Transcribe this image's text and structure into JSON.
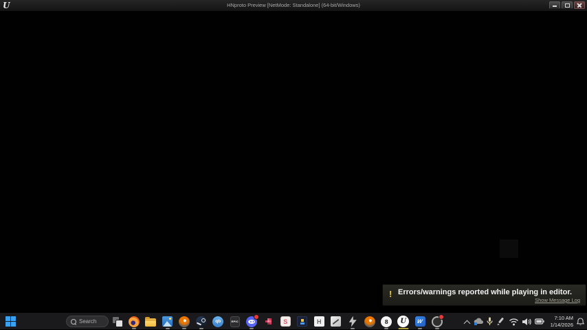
{
  "window": {
    "title": "HNproto Preview [NetMode: Standalone]  (64-bit/Windows)",
    "app_icon_glyph": "U",
    "controls": [
      "minimize",
      "maximize",
      "close"
    ]
  },
  "viewport": {
    "background": "#000000"
  },
  "toast": {
    "warning_glyph": "!",
    "message": "Errors/warnings reported while playing in editor.",
    "link_label": "Show Message Log",
    "accent_color": "#ddc83d"
  },
  "taskbar": {
    "search": {
      "placeholder": "Search"
    },
    "active_indicator_color": "#b3a23a",
    "apps": [
      {
        "id": "task-view",
        "glyph": "",
        "running": false,
        "active": false,
        "badge": false
      },
      {
        "id": "firefox",
        "glyph": "",
        "running": true,
        "active": false,
        "badge": false
      },
      {
        "id": "explorer",
        "glyph": "",
        "running": false,
        "active": false,
        "badge": false
      },
      {
        "id": "photos",
        "glyph": "",
        "running": true,
        "active": false,
        "badge": false
      },
      {
        "id": "blender",
        "glyph": "",
        "running": true,
        "active": false,
        "badge": false
      },
      {
        "id": "steam",
        "glyph": "",
        "running": true,
        "active": false,
        "badge": false
      },
      {
        "id": "qbittorrent",
        "glyph": "qb",
        "running": false,
        "active": false,
        "badge": false
      },
      {
        "id": "epic",
        "glyph": "EPIC",
        "running": false,
        "active": false,
        "badge": false
      },
      {
        "id": "discord",
        "glyph": "",
        "running": true,
        "active": false,
        "badge": true
      },
      {
        "id": "aseprite",
        "glyph": "",
        "running": false,
        "active": false,
        "badge": false
      },
      {
        "id": "s-app",
        "glyph": "S",
        "running": false,
        "active": false,
        "badge": false
      },
      {
        "id": "pixelgame",
        "glyph": "",
        "running": false,
        "active": false,
        "badge": false
      },
      {
        "id": "h-app",
        "glyph": "H",
        "running": false,
        "active": false,
        "badge": false
      },
      {
        "id": "notes",
        "glyph": "",
        "running": false,
        "active": false,
        "badge": false
      },
      {
        "id": "lightning",
        "glyph": "",
        "running": true,
        "active": false,
        "badge": false
      },
      {
        "id": "blender-2",
        "glyph": "",
        "running": false,
        "active": false,
        "badge": false
      },
      {
        "id": "eight",
        "glyph": "8",
        "running": true,
        "active": false,
        "badge": false
      },
      {
        "id": "unreal",
        "glyph": "U",
        "running": true,
        "active": true,
        "badge": false
      },
      {
        "id": "wallpaper",
        "glyph": "W",
        "running": true,
        "active": false,
        "badge": false
      },
      {
        "id": "clockbadge",
        "glyph": "",
        "running": true,
        "active": false,
        "badge": true
      }
    ],
    "tray": {
      "icons": [
        "hidden-icons-chevron",
        "onedrive",
        "microphone",
        "pen",
        "wifi",
        "volume",
        "battery",
        "notification-bell"
      ],
      "time": "7:10 AM",
      "date": "1/14/2026"
    }
  }
}
